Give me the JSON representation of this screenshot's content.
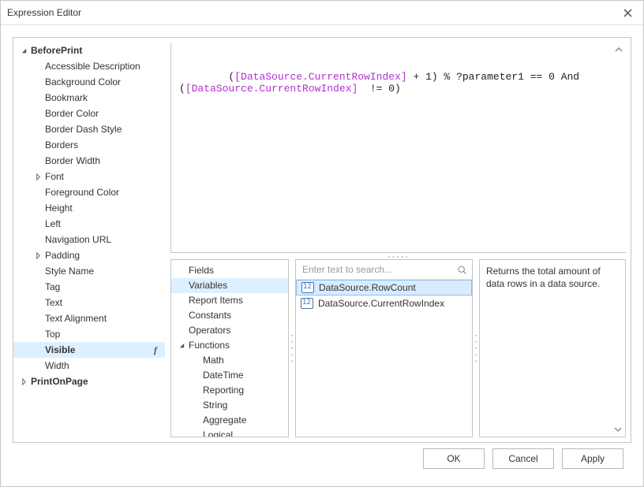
{
  "window": {
    "title": "Expression Editor"
  },
  "tree": {
    "groups": [
      {
        "label": "BeforePrint",
        "expanded": true,
        "items": [
          {
            "label": "Accessible Description"
          },
          {
            "label": "Background Color"
          },
          {
            "label": "Bookmark"
          },
          {
            "label": "Border Color"
          },
          {
            "label": "Border Dash Style"
          },
          {
            "label": "Borders"
          },
          {
            "label": "Border Width"
          },
          {
            "label": "Font",
            "has_children": true
          },
          {
            "label": "Foreground Color"
          },
          {
            "label": "Height"
          },
          {
            "label": "Left"
          },
          {
            "label": "Navigation URL"
          },
          {
            "label": "Padding",
            "has_children": true
          },
          {
            "label": "Style Name"
          },
          {
            "label": "Tag"
          },
          {
            "label": "Text"
          },
          {
            "label": "Text Alignment"
          },
          {
            "label": "Top"
          },
          {
            "label": "Visible",
            "selected": true,
            "fx": true
          },
          {
            "label": "Width"
          }
        ]
      },
      {
        "label": "PrintOnPage",
        "expanded": false
      }
    ]
  },
  "expression": {
    "line1_pre": "(",
    "line1_ds": "[DataSource.CurrentRowIndex]",
    "line1_post": " + 1) % ?parameter1 == 0 And",
    "line2_pre": "(",
    "line2_ds": "[DataSource.CurrentRowIndex]",
    "line2_post": "  != 0)"
  },
  "categories": {
    "items": [
      {
        "label": "Fields",
        "indent": 1
      },
      {
        "label": "Variables",
        "indent": 1,
        "selected": true
      },
      {
        "label": "Report Items",
        "indent": 1
      },
      {
        "label": "Constants",
        "indent": 1
      },
      {
        "label": "Operators",
        "indent": 1
      },
      {
        "label": "Functions",
        "indent": 1,
        "arrow": "down",
        "has_children": true
      },
      {
        "label": "Math",
        "indent": 2
      },
      {
        "label": "DateTime",
        "indent": 2
      },
      {
        "label": "Reporting",
        "indent": 2
      },
      {
        "label": "String",
        "indent": 2
      },
      {
        "label": "Aggregate",
        "indent": 2
      },
      {
        "label": "Logical",
        "indent": 2
      }
    ]
  },
  "list": {
    "search_placeholder": "Enter text to search...",
    "items": [
      {
        "label": "DataSource.RowCount",
        "selected": true
      },
      {
        "label": "DataSource.CurrentRowIndex"
      }
    ]
  },
  "description": "Returns the total amount of data rows in a data source.",
  "buttons": {
    "ok": "OK",
    "cancel": "Cancel",
    "apply": "Apply"
  }
}
